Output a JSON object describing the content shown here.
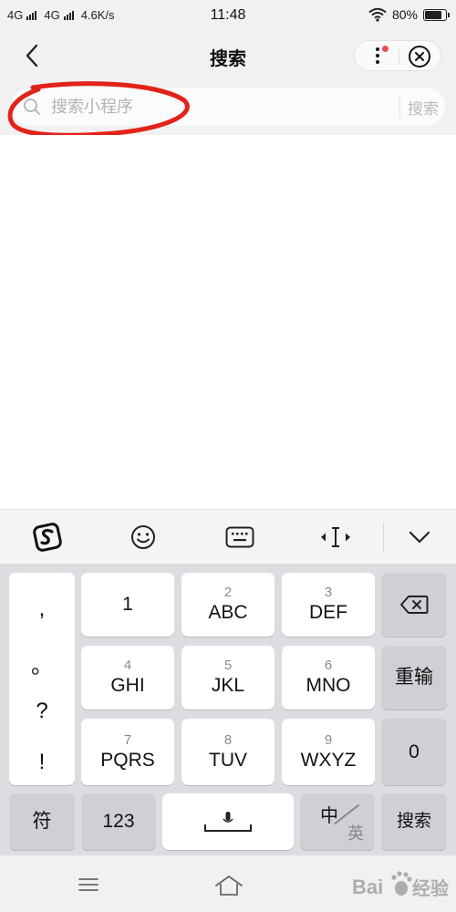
{
  "status_bar": {
    "network1": "4G",
    "network2": "4G",
    "speed": "4.6K/s",
    "time": "11:48",
    "battery": "80%",
    "battery_level": 0.8
  },
  "nav": {
    "title": "搜索"
  },
  "search": {
    "placeholder": "搜索小程序",
    "button_label": "搜索"
  },
  "keyboard": {
    "punctuation": [
      ",",
      "。",
      "?",
      "!"
    ],
    "keys": [
      {
        "num": "",
        "main": "1"
      },
      {
        "num": "2",
        "main": "ABC"
      },
      {
        "num": "3",
        "main": "DEF"
      },
      {
        "num": "4",
        "main": "GHI"
      },
      {
        "num": "5",
        "main": "JKL"
      },
      {
        "num": "6",
        "main": "MNO"
      },
      {
        "num": "7",
        "main": "PQRS"
      },
      {
        "num": "8",
        "main": "TUV"
      },
      {
        "num": "9",
        "main": "WXYZ"
      }
    ],
    "retype_label": "重输",
    "zero_label": "0",
    "symbol_label": "符",
    "numeric_label": "123",
    "lang_zh": "中",
    "lang_en": "英",
    "enter_label": "搜索"
  },
  "watermark": {
    "text": "经验",
    "brand": "Bai"
  },
  "colors": {
    "annotation_red": "#e2231a",
    "badge_red": "#f04b4b"
  }
}
